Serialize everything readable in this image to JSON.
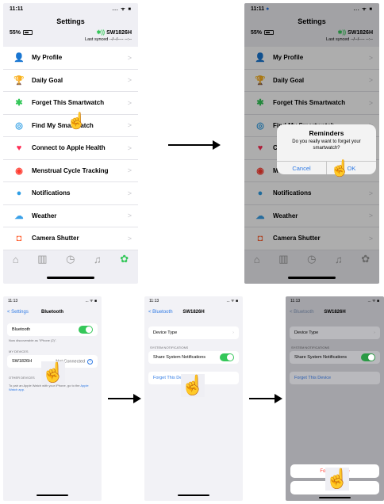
{
  "phone1": {
    "time": "11:11",
    "status_icons": "... ᯤ ■",
    "title": "Settings",
    "battery": "55%",
    "device_name": "SW1826H",
    "last_synced": "Last synced --/--/---- --:--",
    "menu": [
      {
        "label": "My Profile",
        "icon": "person-icon",
        "glyph": "👤",
        "color": "#2f7ae5"
      },
      {
        "label": "Daily Goal",
        "icon": "trophy-icon",
        "glyph": "🏆",
        "color": "#f2a200"
      },
      {
        "label": "Forget This Smartwatch",
        "icon": "bluetooth-icon",
        "glyph": "✱",
        "color": "#34c759"
      },
      {
        "label": "Find My Smartwatch",
        "icon": "target-icon",
        "glyph": "◎",
        "color": "#2f9ee5"
      },
      {
        "label": "Connect to Apple Health",
        "icon": "heart-icon",
        "glyph": "♥",
        "color": "#ff2d55"
      },
      {
        "label": "Menstrual Cycle Tracking",
        "icon": "cycle-icon",
        "glyph": "◉",
        "color": "#ff3b30"
      },
      {
        "label": "Notifications",
        "icon": "chat-icon",
        "glyph": "●",
        "color": "#2f9ee5"
      },
      {
        "label": "Weather",
        "icon": "cloud-icon",
        "glyph": "☁",
        "color": "#3aa0e8"
      },
      {
        "label": "Camera Shutter",
        "icon": "camera-icon",
        "glyph": "◘",
        "color": "#ff6a3d"
      }
    ],
    "chevron": ">"
  },
  "phone2": {
    "time": "11:11",
    "alert_title": "Reminders",
    "alert_message": "Do you really want to forget your smartwatch?",
    "cancel": "Cancel",
    "ok": "OK"
  },
  "phone3": {
    "time": "11:13",
    "back": "< Settings",
    "title": "Bluetooth",
    "bluetooth_label": "Bluetooth",
    "discoverable_note": "Now discoverable as \"iPhone (2)\".",
    "my_devices_header": "MY DEVICES",
    "device_name": "SW1826H",
    "device_status": "Not Connected",
    "other_devices_header": "OTHER DEVICES",
    "pair_note": "To pair an Apple Watch with your iPhone, go to the",
    "pair_link": "Apple Watch app."
  },
  "phone4": {
    "time": "11:13",
    "back": "< Bluetooth",
    "title": "SW1826H",
    "device_type": "Device Type",
    "system_notifications_header": "SYSTEM NOTIFICATIONS",
    "share_notifications": "Share System Notifications",
    "forget": "Forget This Device"
  },
  "phone5": {
    "time": "11:13",
    "back": "< Bluetooth",
    "title": "SW1826H",
    "device_type": "Device Type",
    "system_notifications_header": "SYSTEM NOTIFICATIONS",
    "share_notifications": "Share System Notifications",
    "forget": "Forget This Device",
    "sheet_forget": "Forget Device",
    "sheet_cancel": "Cancel"
  },
  "colors": {
    "accent": "#2f7ae5",
    "destructive": "#ff3b30",
    "toggle_on": "#34c759",
    "settings_tab": "#34c759"
  }
}
